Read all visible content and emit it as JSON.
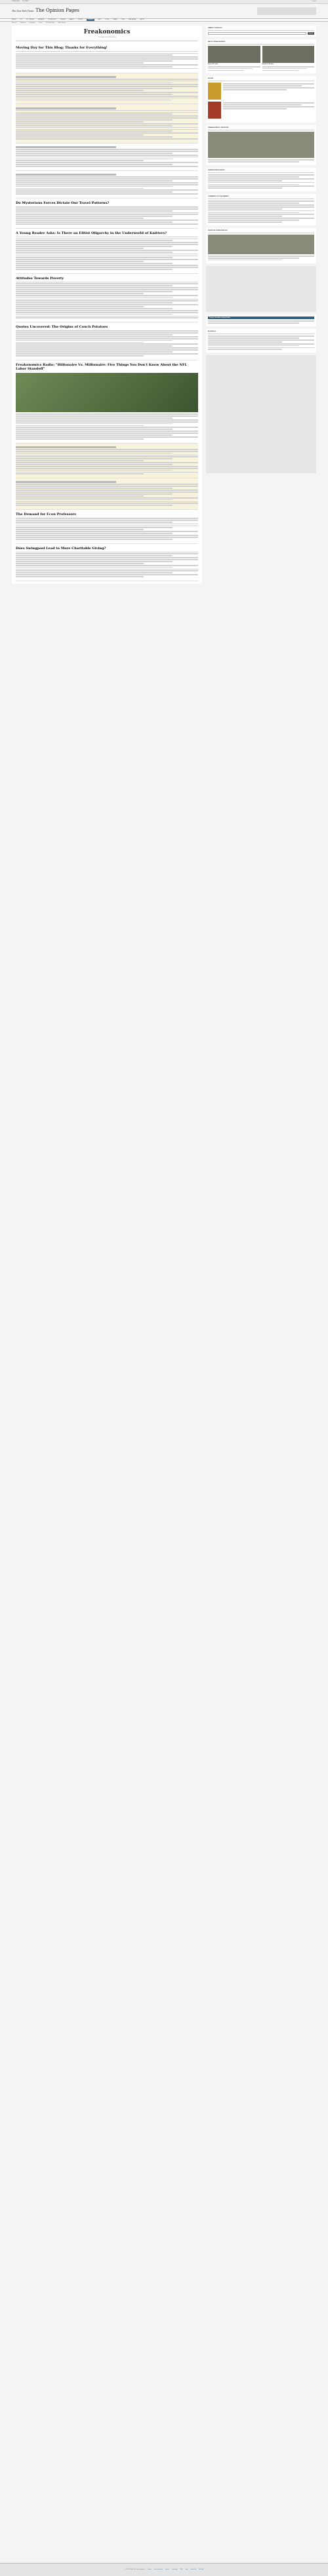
{
  "topbar": {
    "left": "HOME PAGE",
    "mid": "MY TIMES",
    "right": "Log In"
  },
  "masthead": {
    "logo": "The New York Times",
    "section": "The Opinion Pages"
  },
  "nav": [
    "World",
    "U.S.",
    "N.Y. / Region",
    "Business",
    "Technology",
    "Science",
    "Health",
    "Sports",
    "Opinion",
    "Arts",
    "Style",
    "Travel",
    "Jobs",
    "Real Estate",
    "Autos"
  ],
  "nav_active": "Opinion",
  "subnav": [
    "Editorials",
    "Columnists",
    "Contributors",
    "Letters",
    "The Public Editor",
    "Global Opinion"
  ],
  "blog": {
    "name": "Freakonomics",
    "tagline": "The Hidden Side of Everything"
  },
  "posts": [
    {
      "date": "",
      "title": "Moving Day for This Blog; Thanks for Everything!",
      "byline": "",
      "more": "",
      "highlight": false,
      "lines": 10,
      "image": false
    },
    {
      "date": "",
      "title": "",
      "byline": "",
      "more": "",
      "highlight": true,
      "lines": 12,
      "image": false
    },
    {
      "date": "",
      "title": "",
      "byline": "",
      "more": "",
      "highlight": true,
      "lines": 16,
      "image": false
    },
    {
      "date": "",
      "title": "",
      "byline": "",
      "more": "",
      "highlight": false,
      "lines": 10,
      "image": false
    },
    {
      "date": "",
      "title": "",
      "byline": "",
      "more": "",
      "highlight": false,
      "lines": 10,
      "image": false
    },
    {
      "date": "",
      "title": "Do Mysterious Forces Dictate Our Travel Patterns?",
      "byline": "",
      "more": "",
      "highlight": false,
      "lines": 10,
      "image": false
    },
    {
      "date": "",
      "title": "A Young Reader Asks: Is There an Elitist Oligarchy in the Underworld of Knitters?",
      "byline": "",
      "more": "",
      "highlight": false,
      "lines": 18,
      "image": false
    },
    {
      "date": "",
      "title": "Attitudes Towards Poverty",
      "byline": "",
      "more": "",
      "highlight": false,
      "lines": 20,
      "image": false
    },
    {
      "date": "",
      "title": "Quotes Uncovered: The Origins of Couch Potatoes",
      "byline": "",
      "more": "",
      "highlight": false,
      "lines": 14,
      "image": false
    },
    {
      "date": "",
      "title": "Freakonomics Radio: \"Billionaire Vs. Millionaire: Five Things You Don't Know About the NFL Labor Standoff\"",
      "byline": "",
      "more": "",
      "highlight": false,
      "lines": 14,
      "image": true
    },
    {
      "date": "",
      "title": "",
      "byline": "",
      "more": "",
      "highlight": true,
      "lines": 14,
      "image": false
    },
    {
      "date": "",
      "title": "",
      "byline": "",
      "more": "",
      "highlight": true,
      "lines": 12,
      "image": false
    },
    {
      "date": "",
      "title": "The Demand for Econ Professors",
      "byline": "",
      "more": "",
      "highlight": false,
      "lines": 12,
      "image": false
    },
    {
      "date": "",
      "title": "Does Swingpool Lead to More Charitable Giving?",
      "byline": "",
      "more": "",
      "highlight": false,
      "lines": 14,
      "image": false
    }
  ],
  "sidebar": {
    "search_label": "Search This Blog",
    "search_placeholder": "",
    "search_button": "Search",
    "about_heading": "About Freakonomics",
    "books_heading": "Books",
    "featured_heading": "Freakonomics: The Movie",
    "categories_heading": "Freakonomics Radio",
    "comments_heading": "Comments of the Moment",
    "blogroll_heading": "Blogroll",
    "archive_heading": "From The Opinion Blogs",
    "headlines_heading": "Today's Headlines Daily E-Mail",
    "authors": [
      {
        "name": "Steven D. Levitt"
      },
      {
        "name": "Stephen J. Dubner"
      }
    ],
    "links": [
      "",
      "",
      "",
      "",
      "",
      "",
      "",
      ""
    ]
  },
  "footer": {
    "copyright": "© 2011 The New York Times Company",
    "links": [
      "Privacy",
      "Terms of Service",
      "Search",
      "Corrections",
      "RSS",
      "Help",
      "Contact Us",
      "Site Map"
    ]
  }
}
